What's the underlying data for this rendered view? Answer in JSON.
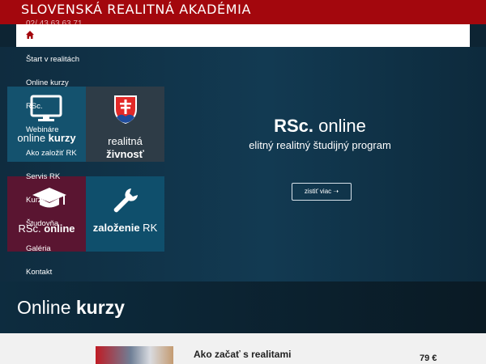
{
  "header": {
    "brand": "SLOVENSKÁ  REALITNÁ  AKADÉMIA",
    "phone": "02/ 43 63 63 71"
  },
  "nav": {
    "home_icon": "home-icon"
  },
  "menu": {
    "items": [
      "Štart v realitách",
      "Online kurzy",
      "RSc.",
      "Webináre",
      "Ako založiť RK",
      "Servis RK",
      "Kurzy",
      "Študovňa",
      "Galéria",
      "Kontakt"
    ]
  },
  "tiles": [
    {
      "icon": "monitor-icon",
      "line1": "online ",
      "line1b": "kurzy",
      "line2": "",
      "line2b": ""
    },
    {
      "icon": "slovak-crest-icon",
      "line1": "realitná",
      "line1b": "",
      "line2": "",
      "line2b": "živnosť"
    },
    {
      "icon": "graduation-cap-icon",
      "line1": "RSc. ",
      "line1b": "online",
      "line2": "",
      "line2b": ""
    },
    {
      "icon": "wrench-icon",
      "line1": "",
      "line1b": "založenie",
      "line2": " RK",
      "line2b": ""
    }
  ],
  "hero": {
    "title_bold": "RSc.",
    "title_rest": " online",
    "subtitle": "elitný realitný študijný program",
    "cta": "zistiť viac ➝"
  },
  "section": {
    "title_plain": "Online ",
    "title_bold": "kurzy"
  },
  "course": {
    "title": "Ako začať s realitami",
    "price": "79 €"
  },
  "colors": {
    "topbar": "#a3070d",
    "tile_blue": "#14526e",
    "tile_gray": "#2e3c47",
    "tile_maroon": "#5a1531"
  }
}
